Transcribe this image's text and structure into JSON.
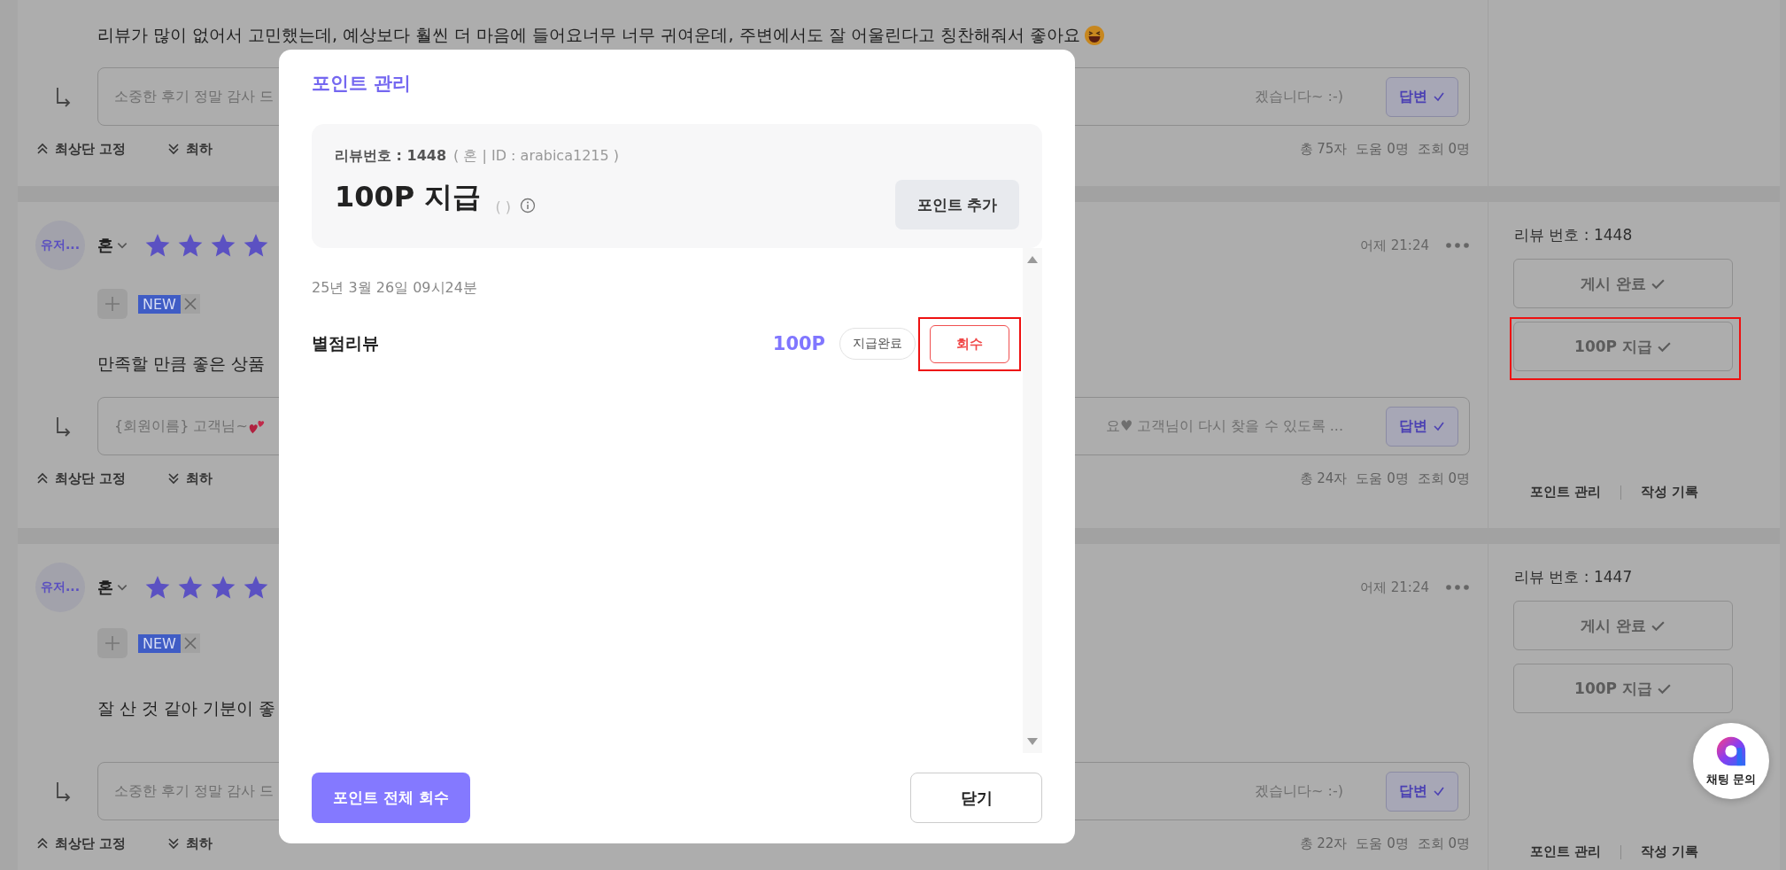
{
  "reviews": [
    {
      "kind": "top_cut",
      "text": "리뷰가 많이 없어서 고민했는데, 예상보다 훨씬 더 마음에 들어요너무 너무 귀여운데, 주변에서도 잘 어울린다고 칭찬해줘서 좋아요",
      "reply": {
        "left": "소중한 후기 정말 감사 드",
        "right": "겠습니다~ :-)",
        "button": "답변"
      },
      "actions": [
        "최상단 고정",
        "최하"
      ],
      "stats": [
        "총 75자",
        "도움 0명",
        "조회 0명"
      ]
    },
    {
      "kind": "full",
      "avatar": "유저...",
      "name": "혼",
      "stars": 4,
      "time": "어제 21:24",
      "tag": "NEW",
      "text": "만족할 만큼 좋은 상품",
      "reply": {
        "left": "{회원이름} 고객님~",
        "right": "요♥ 고객님이 다시 찾을 수 있도록 ...",
        "button": "답변"
      },
      "actions": [
        "최상단 고정",
        "최하"
      ],
      "stats": [
        "총 24자",
        "도움 0명",
        "조회 0명"
      ],
      "side": {
        "number": "리뷰 번호 : 1448",
        "buttons": [
          {
            "label": "게시 완료",
            "highlighted": false
          },
          {
            "label": "100P 지급",
            "highlighted": true
          }
        ],
        "links": [
          "포인트 관리",
          "작성 기록"
        ]
      }
    },
    {
      "kind": "full",
      "avatar": "유저...",
      "name": "혼",
      "stars": 4,
      "time": "어제 21:24",
      "tag": "NEW",
      "text": "잘 산 것 같아 기분이 좋",
      "reply": {
        "left": "소중한 후기 정말 감사 드",
        "right": "겠습니다~ :-)",
        "button": "답변"
      },
      "actions": [
        "최상단 고정",
        "최하"
      ],
      "stats": [
        "총 22자",
        "도움 0명",
        "조회 0명"
      ],
      "side": {
        "number": "리뷰 번호 : 1447",
        "buttons": [
          {
            "label": "게시 완료",
            "highlighted": false
          },
          {
            "label": "100P 지급",
            "highlighted": false
          }
        ],
        "links": [
          "포인트 관리",
          "작성 기록"
        ]
      }
    }
  ],
  "modal": {
    "title": "포인트 관리",
    "review_label": "리뷰번호 : 1448",
    "review_meta": "( 혼 | ID : arabica1215 )",
    "amount": "100P 지급",
    "amount_note": "( )",
    "add_button": "포인트 추가",
    "entries": [
      {
        "date": "25년 3월 26일 09시24분",
        "title": "별점리뷰",
        "points": "100P",
        "status": "지급완료",
        "action": {
          "label": "회수",
          "highlighted": true
        }
      }
    ],
    "revoke_all_button": "포인트 전체 회수",
    "close_button": "닫기"
  },
  "chat_button": {
    "label": "채팅 문의"
  }
}
